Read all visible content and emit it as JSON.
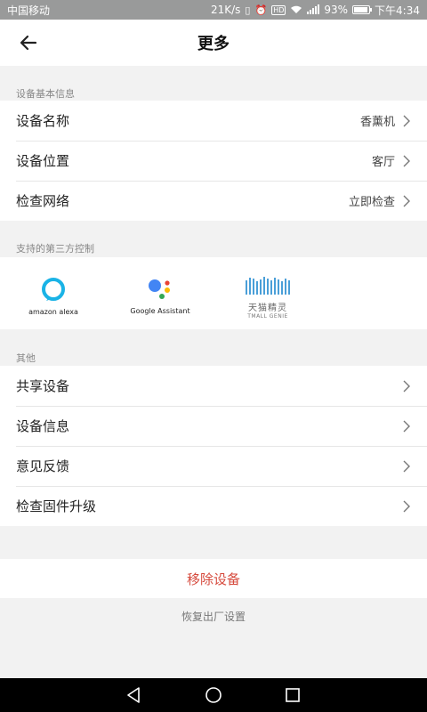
{
  "status_bar": {
    "carrier": "中国移动",
    "net_speed": "21K/s",
    "hd": "HD",
    "battery_percent": "93%",
    "battery_level": 0.93,
    "time": "下午4:34"
  },
  "header": {
    "title": "更多"
  },
  "sections": {
    "basic": {
      "label": "设备基本信息",
      "rows": [
        {
          "label": "设备名称",
          "value": "香薰机"
        },
        {
          "label": "设备位置",
          "value": "客厅"
        },
        {
          "label": "检查网络",
          "value": "立即检查"
        }
      ]
    },
    "thirdparty": {
      "label": "支持的第三方控制",
      "items": [
        {
          "caption": "amazon alexa",
          "icon": "alexa-icon"
        },
        {
          "caption": "Google Assistant",
          "icon": "google-assistant-icon"
        },
        {
          "caption": "天猫精灵",
          "caption2": "TMALL GENIE",
          "icon": "tmall-genie-icon"
        }
      ]
    },
    "other": {
      "label": "其他",
      "rows": [
        {
          "label": "共享设备"
        },
        {
          "label": "设备信息"
        },
        {
          "label": "意见反馈"
        },
        {
          "label": "检查固件升级"
        }
      ]
    }
  },
  "actions": {
    "remove": "移除设备",
    "reset": "恢复出厂设置"
  },
  "colors": {
    "danger": "#d64a3d",
    "alexa": "#1ab3e6",
    "google_blue": "#4285f4",
    "google_red": "#ea4335",
    "google_yellow": "#fbbc05",
    "google_green": "#34a853",
    "tmall": "#4a9fd8"
  }
}
